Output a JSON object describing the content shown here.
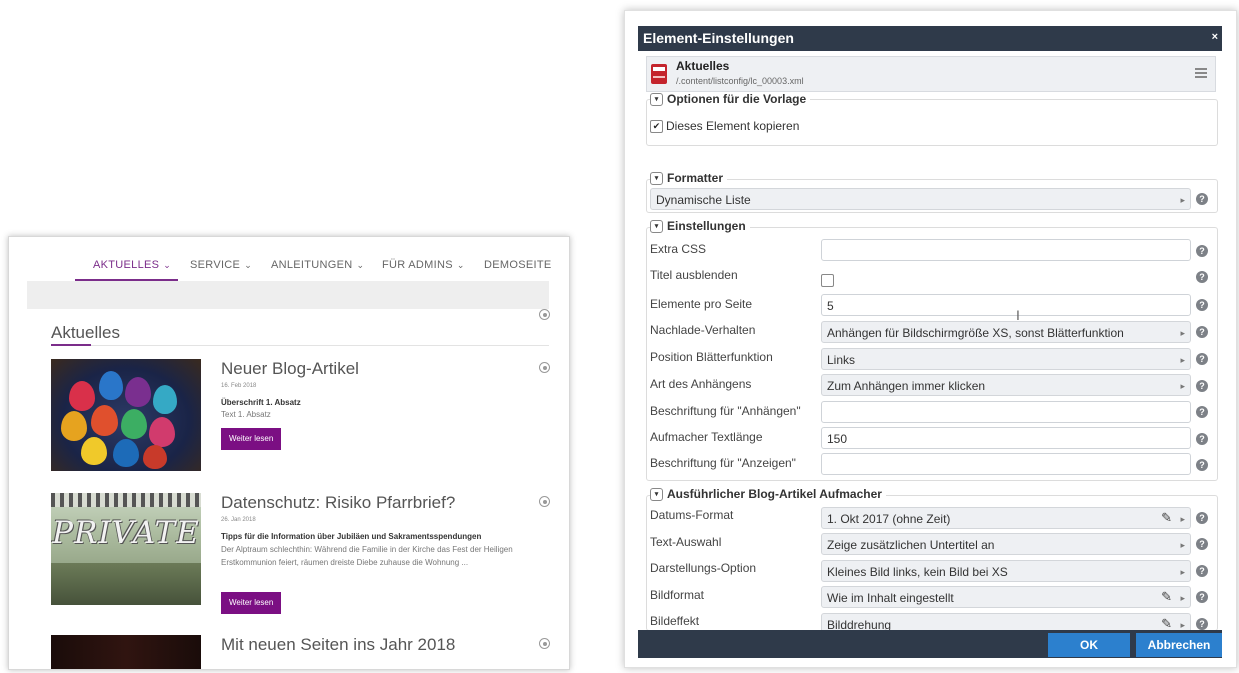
{
  "site": {
    "nav": [
      {
        "label": "AKTUELLES",
        "active": true
      },
      {
        "label": "SERVICE",
        "active": false
      },
      {
        "label": "ANLEITUNGEN",
        "active": false
      },
      {
        "label": "FÜR ADMINS",
        "active": false
      },
      {
        "label": "DEMOSEITE",
        "active": false
      }
    ],
    "chevron": "⌄",
    "heading": "Aktuelles",
    "posts": [
      {
        "title": "Neuer Blog-Artikel",
        "date": "16. Feb 2018",
        "subtitle": "Überschrift 1. Absatz",
        "text": "Text 1. Absatz",
        "button": "Weiter lesen"
      },
      {
        "title": "Datenschutz: Risiko Pfarrbrief?",
        "date": "26. Jan 2018",
        "subtitle": "Tipps für die Information über Jubiläen und Sakramentsspendungen",
        "text": "Der Alptraum schlechthin: Während die Familie in der Kirche das Fest der Heiligen Erstkommunion feiert, räumen dreiste Diebe zuhause die Wohnung ...",
        "image_text": "PRIVATE",
        "button": "Weiter lesen"
      },
      {
        "title": "Mit neuen Seiten ins Jahr 2018"
      }
    ]
  },
  "dialog": {
    "title": "Element-Einstellungen",
    "close": "×",
    "resource": {
      "title": "Aktuelles",
      "path": "/.content/listconfig/lc_00003.xml"
    },
    "sections": {
      "template_options": "Optionen für die Vorlage",
      "formatter": "Formatter",
      "settings": "Einstellungen",
      "detail": "Ausführlicher Blog-Artikel Aufmacher"
    },
    "toggle_glyph": "▾",
    "copy_element": {
      "label": "Dieses Element kopieren",
      "checked": true,
      "check_glyph": "✔"
    },
    "formatter_value": "Dynamische Liste",
    "arrow": "▸",
    "pencil": "✎",
    "help": "?",
    "cursor": "I",
    "settings": [
      {
        "label": "Extra CSS",
        "type": "input",
        "value": ""
      },
      {
        "label": "Titel ausblenden",
        "type": "checkbox",
        "value": ""
      },
      {
        "label": "Elemente pro Seite",
        "type": "input",
        "value": "5"
      },
      {
        "label": "Nachlade-Verhalten",
        "type": "select",
        "value": "Anhängen für Bildschirmgröße XS, sonst Blätterfunktion"
      },
      {
        "label": "Position Blätterfunktion",
        "type": "select",
        "value": "Links"
      },
      {
        "label": "Art des Anhängens",
        "type": "select",
        "value": "Zum Anhängen immer klicken"
      },
      {
        "label": "Beschriftung für \"Anhängen\"",
        "type": "input",
        "value": ""
      },
      {
        "label": "Aufmacher Textlänge",
        "type": "input",
        "value": "150"
      },
      {
        "label": "Beschriftung für \"Anzeigen\"",
        "type": "input",
        "value": ""
      }
    ],
    "detail": [
      {
        "label": "Datums-Format",
        "value": "1. Okt 2017 (ohne Zeit)",
        "pencil": true
      },
      {
        "label": "Text-Auswahl",
        "value": "Zeige zusätzlichen Untertitel an",
        "pencil": false
      },
      {
        "label": "Darstellungs-Option",
        "value": "Kleines Bild links, kein Bild bei XS",
        "pencil": false
      },
      {
        "label": "Bildformat",
        "value": "Wie im Inhalt eingestellt",
        "pencil": true
      },
      {
        "label": "Bildeffekt",
        "value": "Bilddrehung",
        "pencil": true
      }
    ],
    "buttons": {
      "ok": "OK",
      "cancel": "Abbrechen"
    }
  },
  "colors": {
    "accent_purple": "#7b2d8a",
    "button_purple": "#7b0f83",
    "dialog_header": "#2f3a4a",
    "primary_button": "#2c80ce",
    "resource_icon": "#c4242c"
  }
}
